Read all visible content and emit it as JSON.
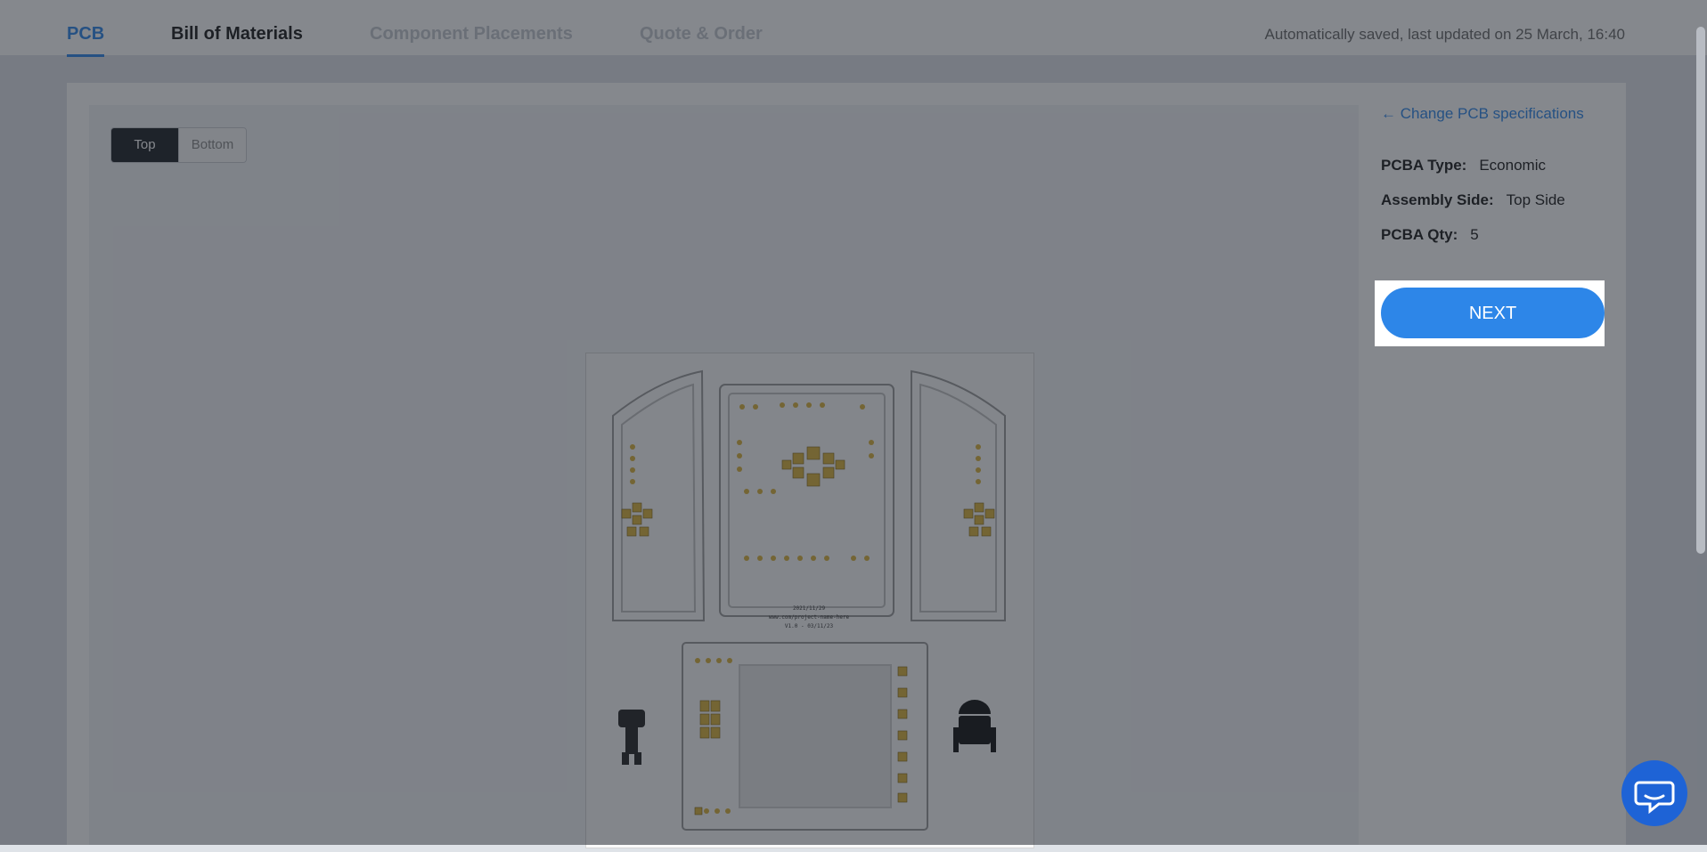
{
  "nav": {
    "tabs": [
      {
        "label": "PCB",
        "state": "active"
      },
      {
        "label": "Bill of Materials",
        "state": "normal"
      },
      {
        "label": "Component Placements",
        "state": "disabled"
      },
      {
        "label": "Quote & Order",
        "state": "disabled"
      }
    ],
    "saved_text": "Automatically saved, last updated on 25 March, 16:40"
  },
  "viewer": {
    "toggle": {
      "top": "Top",
      "bottom": "Bottom",
      "selected": "Top"
    },
    "board_text": {
      "line1": "2021/11/29",
      "line2": "www.com/project-name-here",
      "line3": "V1.0 - 03/11/23"
    }
  },
  "side": {
    "change_link": "← Change PCB specifications",
    "specs": [
      {
        "label": "PCBA Type:",
        "value": "Economic"
      },
      {
        "label": "Assembly Side:",
        "value": "Top Side"
      },
      {
        "label": "PCBA Qty:",
        "value": "5"
      }
    ],
    "next_label": "NEXT"
  },
  "colors": {
    "accent": "#2d86e8",
    "pad": "#d9b23a",
    "overlay": "rgba(32,38,48,0.55)",
    "chat": "#1e63d6"
  },
  "icons": {
    "chat": "chat-bubble-icon",
    "back": "arrow-left-icon"
  }
}
